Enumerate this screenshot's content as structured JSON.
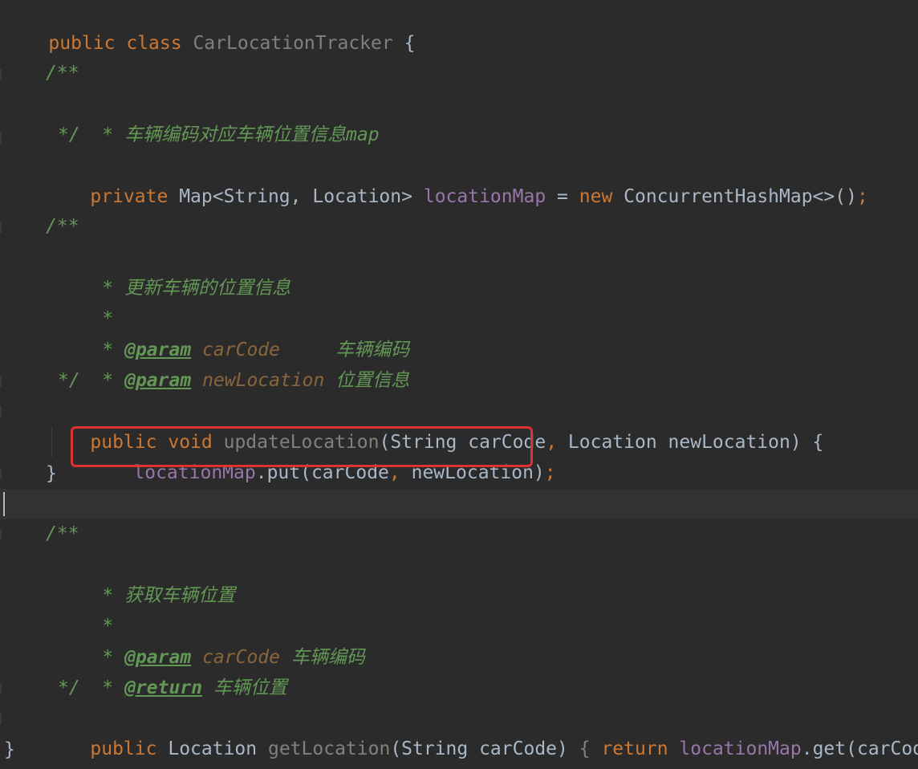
{
  "code": {
    "class_kw_public": "public",
    "class_kw_class": "class",
    "class_name": "CarLocationTracker",
    "brace_open": "{",
    "doc_open": "/**",
    "doc_close": "*/",
    "doc_star": "*",
    "map_doc_text": "车辆编码对应车辆位置信息map",
    "field_private": "private",
    "field_type": "Map<String, Location>",
    "field_name": "locationMap",
    "field_assign": "=",
    "field_new": "new",
    "field_init": "ConcurrentHashMap<>()",
    "semicolon": ";",
    "update_doc_text": "更新车辆的位置信息",
    "param_tag": "@param",
    "return_tag": "@return",
    "p_carcode": "carCode",
    "p_carcode_desc": "车辆编码",
    "p_newlocation": "newLocation",
    "p_newlocation_desc": "位置信息",
    "m_public": "public",
    "m_void": "void",
    "m_update_name": "updateLocation",
    "m_update_params_a": "(String carCode",
    "comma": ",",
    "m_update_params_b": "Location newLocation) {",
    "body_field": "locationMap",
    "body_call": ".put(carCode",
    "body_arg": "newLocation)",
    "brace_close": "}",
    "get_doc_text": "获取车辆位置",
    "return_desc": "车辆位置",
    "m_get_type": "Location",
    "m_get_name": "getLocation",
    "m_get_params": "(String carCode)",
    "m_get_open": "{",
    "m_return": "return",
    "m_get_field": "locationMap",
    "m_get_call": ".get(carCode)",
    "m_get_close": "}"
  }
}
